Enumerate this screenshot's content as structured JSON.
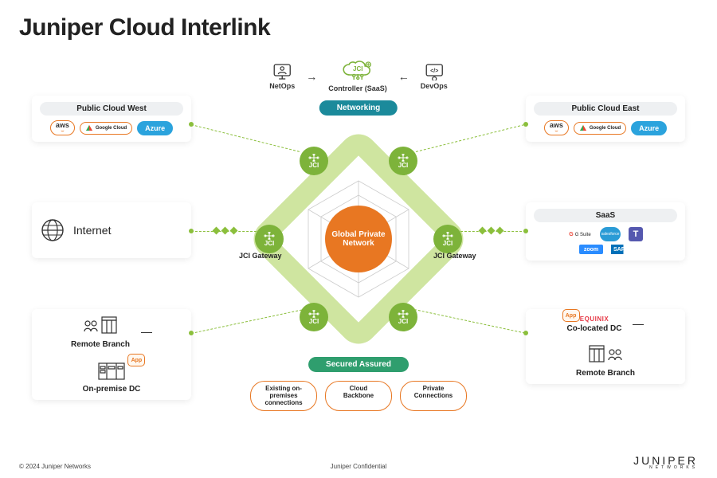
{
  "title": "Juniper Cloud Interlink",
  "footer": {
    "copyright": "© 2024 Juniper Networks",
    "center": "Juniper Confidential",
    "logo": "JUNIPER",
    "logo_sub": "NETWORKS"
  },
  "top": {
    "netops": "NetOps",
    "controller_brand": "JCI",
    "controller_sub": "Controller (SaaS)",
    "devops": "DevOps"
  },
  "banners": {
    "top": "Networking",
    "bottom": "Secured Assured"
  },
  "center": {
    "core": "Global Private Network",
    "node_label": "JCI",
    "gateway_label": "JCI Gateway"
  },
  "left": {
    "public_cloud": {
      "hdr": "Public Cloud West",
      "aws": "aws",
      "gcp": "Google Cloud",
      "azure": "Azure"
    },
    "internet": "Internet",
    "bottom": {
      "remote": "Remote Branch",
      "onprem": "On-premise DC",
      "app": "App"
    }
  },
  "right": {
    "public_cloud": {
      "hdr": "Public Cloud East",
      "aws": "aws",
      "gcp": "Google Cloud",
      "azure": "Azure"
    },
    "saas": {
      "hdr": "SaaS",
      "gsuite": "G Suite",
      "sf": "salesforce",
      "teams": "T",
      "zoom": "zoom",
      "sap": "SAP"
    },
    "bottom": {
      "coloc": "Co-located DC",
      "equinix": "EQUINIX",
      "remote": "Remote Branch",
      "app": "App"
    }
  },
  "bottom_bubbles": {
    "a": "Existing on-premises connections",
    "b": "Cloud Backbone",
    "c": "Private Connections"
  }
}
